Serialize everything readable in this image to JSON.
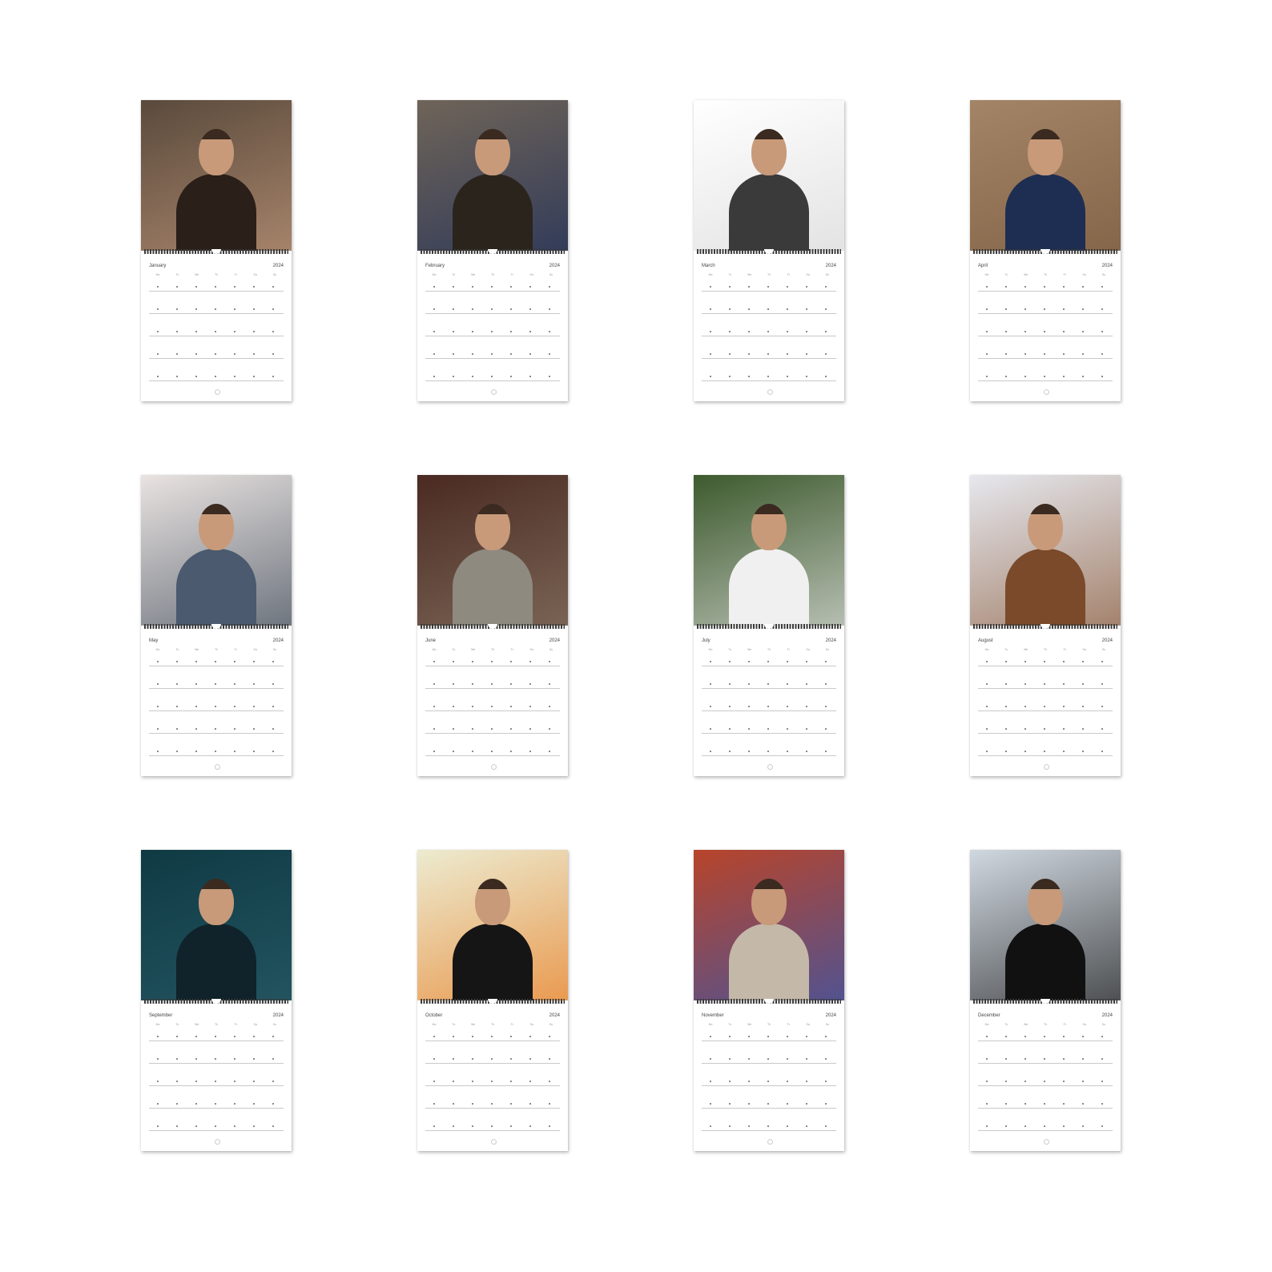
{
  "year": "2024",
  "pages": [
    {
      "month": "January",
      "bg": "#5a4a3c",
      "accent": "#c49a7c",
      "figure": "#2a1f19"
    },
    {
      "month": "February",
      "bg": "#6f6458",
      "accent": "#1b2c5a",
      "figure": "#2b241d"
    },
    {
      "month": "March",
      "bg": "#ffffff",
      "accent": "#d8d8d8",
      "figure": "#3a3a3a"
    },
    {
      "month": "April",
      "bg": "#a38466",
      "accent": "#7a5a3e",
      "figure": "#1e2e52"
    },
    {
      "month": "May",
      "bg": "#e9e3e1",
      "accent": "#3e4a58",
      "figure": "#4b5a6e"
    },
    {
      "month": "June",
      "bg": "#4a2a22",
      "accent": "#8c7a68",
      "figure": "#8e8a80"
    },
    {
      "month": "July",
      "bg": "#3d5a2d",
      "accent": "#e6e6e6",
      "figure": "#f0f0f0"
    },
    {
      "month": "August",
      "bg": "#e6e8ee",
      "accent": "#8a5a3a",
      "figure": "#7a4a2a"
    },
    {
      "month": "September",
      "bg": "#0f3a44",
      "accent": "#2a5e6a",
      "figure": "#10232a"
    },
    {
      "month": "October",
      "bg": "#ecebd0",
      "accent": "#e87a1e",
      "figure": "#151515"
    },
    {
      "month": "November",
      "bg": "#b8442a",
      "accent": "#2a58b8",
      "figure": "#c4b8a8"
    },
    {
      "month": "December",
      "bg": "#d0d8e0",
      "accent": "#1a1a1a",
      "figure": "#111111"
    }
  ],
  "weekday_labels": [
    "Mo",
    "Tu",
    "We",
    "Th",
    "Fr",
    "Sa",
    "Su"
  ]
}
